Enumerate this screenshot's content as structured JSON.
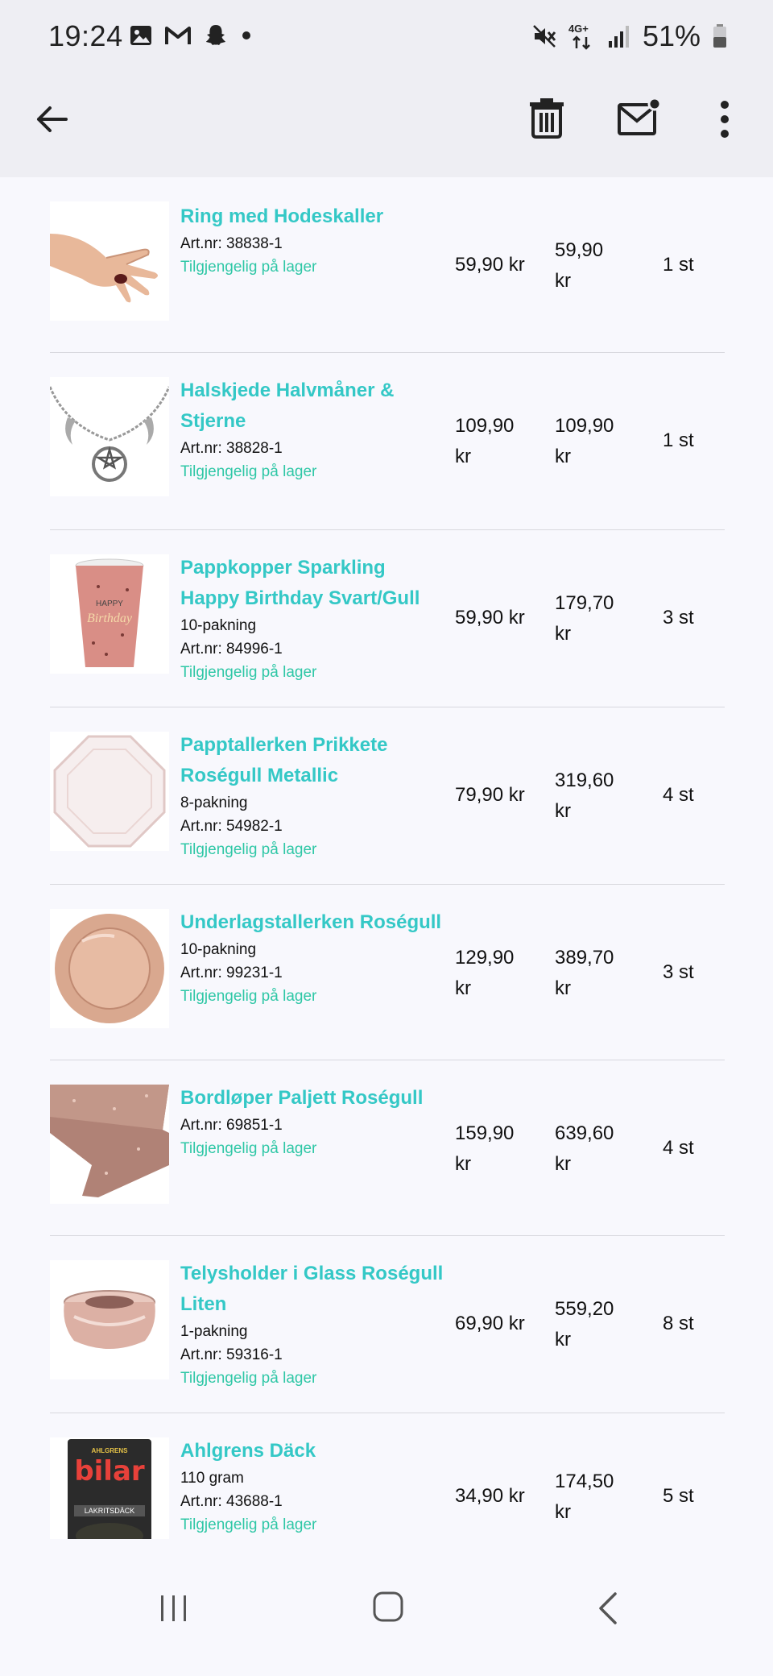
{
  "status_bar": {
    "time": "19:24",
    "battery": "51%",
    "network": "4G+",
    "left_icons": [
      "gallery-icon",
      "gmail-icon",
      "snapchat-icon",
      "dot-icon"
    ],
    "right_icons": [
      "mute-icon",
      "network-icon",
      "signal-icon",
      "battery-icon"
    ]
  },
  "app_bar": {
    "icons": [
      "back-arrow-icon",
      "trash-icon",
      "mail-unread-icon",
      "more-vert-icon"
    ]
  },
  "items": [
    {
      "name_line1": "Ring med Hodeskaller",
      "name_line2": "",
      "pack": "",
      "art": "Art.nr: 38838-1",
      "stock": "Tilgjengelig på lager",
      "price_line1": "59,90 kr",
      "price_line2": "",
      "total_line1": "59,90",
      "total_line2": "kr",
      "qty": "1 st",
      "thumb": "ring"
    },
    {
      "name_line1": "Halskjede Halvmåner &",
      "name_line2": "Stjerne",
      "pack": "",
      "art": "Art.nr: 38828-1",
      "stock": "Tilgjengelig på lager",
      "price_line1": "109,90",
      "price_line2": "kr",
      "total_line1": "109,90",
      "total_line2": "kr",
      "qty": "1 st",
      "thumb": "necklace"
    },
    {
      "name_line1": "Pappkopper Sparkling",
      "name_line2": "Happy Birthday Svart/Gull",
      "pack": "10-pakning",
      "art": "Art.nr: 84996-1",
      "stock": "Tilgjengelig på lager",
      "price_line1": "59,90 kr",
      "price_line2": "",
      "total_line1": "179,70",
      "total_line2": "kr",
      "qty": "3 st",
      "thumb": "cup"
    },
    {
      "name_line1": "Papptallerken Prikkete",
      "name_line2": "Roségull Metallic",
      "pack": "8-pakning",
      "art": "Art.nr: 54982-1",
      "stock": "Tilgjengelig på lager",
      "price_line1": "79,90 kr",
      "price_line2": "",
      "total_line1": "319,60",
      "total_line2": "kr",
      "qty": "4 st",
      "thumb": "plate"
    },
    {
      "name_line1": "Underlagstallerken Roségull",
      "name_line2": "",
      "pack": "10-pakning",
      "art": "Art.nr: 99231-1",
      "stock": "Tilgjengelig på lager",
      "price_line1": "129,90",
      "price_line2": "kr",
      "total_line1": "389,70",
      "total_line2": "kr",
      "qty": "3 st",
      "thumb": "charger"
    },
    {
      "name_line1": "Bordløper Paljett Roségull",
      "name_line2": "",
      "pack": "",
      "art": "Art.nr: 69851-1",
      "stock": "Tilgjengelig på lager",
      "price_line1": "159,90",
      "price_line2": "kr",
      "total_line1": "639,60",
      "total_line2": "kr",
      "qty": "4 st",
      "thumb": "runner"
    },
    {
      "name_line1": "Telysholder i Glass Roségull",
      "name_line2": "Liten",
      "pack": "1-pakning",
      "art": "Art.nr: 59316-1",
      "stock": "Tilgjengelig på lager",
      "price_line1": "69,90 kr",
      "price_line2": "",
      "total_line1": "559,20",
      "total_line2": "kr",
      "qty": "8 st",
      "thumb": "candle"
    },
    {
      "name_line1": "Ahlgrens Däck",
      "name_line2": "",
      "pack": "110 gram",
      "art": "Art.nr: 43688-1",
      "stock": "Tilgjengelig på lager",
      "price_line1": "34,90 kr",
      "price_line2": "",
      "total_line1": "174,50",
      "total_line2": "kr",
      "qty": "5 st",
      "thumb": "candy",
      "brand_top": "AHLGRENS",
      "brand_main": "bilar",
      "brand_bottom": "LAKRITSDÄCK"
    }
  ],
  "nav_bar": {
    "icons": [
      "recent-apps-icon",
      "home-icon",
      "back-icon"
    ]
  },
  "colors": {
    "accent_name": "#34c8c6",
    "in_stock": "#2fc7a6",
    "bar_bg": "#eeeef3",
    "content_bg": "#f8f8fd"
  }
}
